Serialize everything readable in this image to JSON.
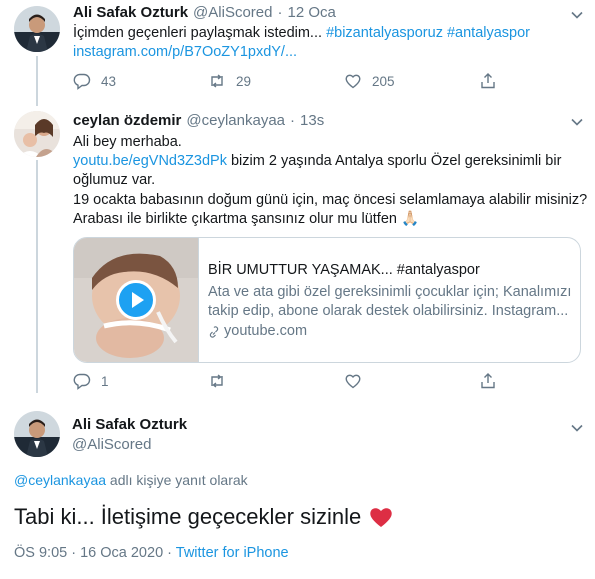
{
  "tweet1": {
    "name": "Ali Safak Ozturk",
    "handle": "@AliScored",
    "separator": "·",
    "date": "12 Oca",
    "text_prefix": "İçimden geçenleri paylaşmak istedim... ",
    "hashtag1": "#bizantalyasporuz",
    "hashtag2": "#antalyaspor",
    "link": "instagram.com/p/B7OoZY1pxdY/...",
    "replies": "43",
    "retweets": "29",
    "likes": "205"
  },
  "tweet2": {
    "name": "ceylan özdemir",
    "handle": "@ceylankayaa",
    "separator": "·",
    "time": "13s",
    "line1": "Ali bey merhaba.",
    "link": "youtu.be/egVNd3Z3dPk",
    "line2_rest": " bizim 2 yaşında Antalya sporlu Özel gereksinimli bir",
    "line3": "oğlumuz var.",
    "line4": "19 ocakta babasının doğum günü için, maç öncesi selamlamaya alabilir misiniz?",
    "line5": "Arabası ile birlikte çıkartma şansınız olur mu lütfen 🙏🏻",
    "card": {
      "title": "BİR UMUTTUR YAŞAMAK... #antalyaspor",
      "desc_line1": "Ata ve ata gibi özel gereksinimli çocuklar için; Kanalımızı",
      "desc_line2": "takip edip, abone olarak destek olabilirsiniz. Instagram...",
      "domain": "youtube.com"
    },
    "replies": "1"
  },
  "tweet3": {
    "name": "Ali Safak Ozturk",
    "handle": "@AliScored",
    "reply_to_handle": "@ceylankayaa",
    "reply_to_suffix": " adlı kişiye yanıt olarak",
    "text": "Tabi ki... İletişime geçecekler sizinle",
    "time": "ÖS 9:05",
    "date": "16 Oca 2020",
    "client": "Twitter for iPhone",
    "meta_sep": " · "
  },
  "colors": {
    "accent": "#1b95e0",
    "muted": "#657786",
    "heart": "#e0245e",
    "divider": "#e6ecf0"
  }
}
